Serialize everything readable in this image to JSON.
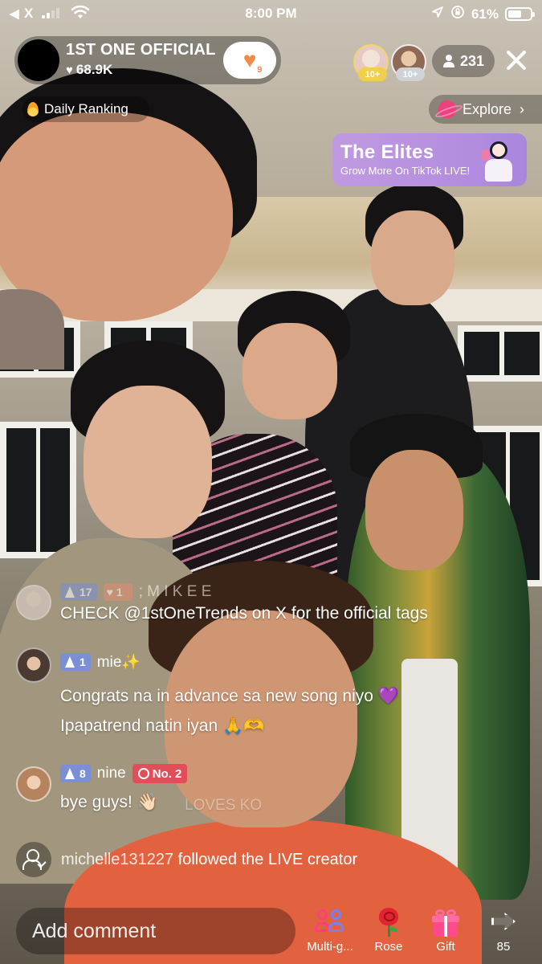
{
  "status_bar": {
    "back": "◀",
    "carrier": "X",
    "time": "8:00 PM",
    "battery": "61%",
    "battery_level": 0.61
  },
  "host": {
    "name": "1ST ONE OFFICIAL",
    "likes": "68.9K",
    "fan_level": "9"
  },
  "top_gifters": [
    {
      "badge": "10+"
    },
    {
      "badge": "10+"
    }
  ],
  "viewer_count": "231",
  "daily_ranking": "Daily Ranking",
  "explore": "Explore",
  "promo": {
    "title": "The Elites",
    "subtitle": "Grow More On TikTok LIVE!"
  },
  "comments": [
    {
      "level": "17",
      "fan_badge": "1",
      "username": "; M I K E E",
      "lines": [
        "CHECK @1stOneTrends on X for the official tags"
      ]
    },
    {
      "level": "1",
      "username": "mie✨",
      "lines": [
        "Congrats na in advance sa new song niyo 💜",
        "Ipapatrend natin iyan 🙏🫶"
      ]
    },
    {
      "level": "8",
      "username": "nine",
      "rank_badge": "No. 2",
      "lines": [
        "bye guys! 👋🏻"
      ],
      "faded_text": "LOVES KO"
    }
  ],
  "follow_event": {
    "username": "michelle131227",
    "text": "followed the LIVE creator"
  },
  "bottom_bar": {
    "comment_placeholder": "Add comment",
    "actions": {
      "multi": "Multi-g...",
      "rose": "Rose",
      "gift": "Gift",
      "share_count": "85"
    }
  }
}
